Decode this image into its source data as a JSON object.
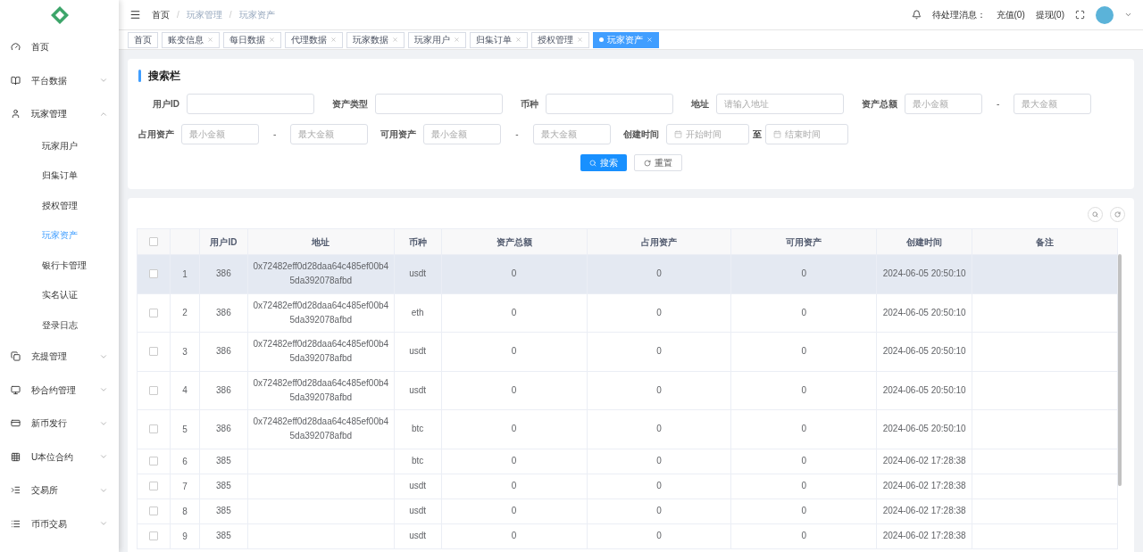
{
  "sidebar": {
    "items": [
      {
        "label": "首页",
        "expandable": false,
        "expanded": false
      },
      {
        "label": "平台数据",
        "expandable": true,
        "expanded": false
      },
      {
        "label": "玩家管理",
        "expandable": true,
        "expanded": true,
        "children": [
          {
            "label": "玩家用户",
            "selected": false
          },
          {
            "label": "归集订单",
            "selected": false
          },
          {
            "label": "授权管理",
            "selected": false
          },
          {
            "label": "玩家资产",
            "selected": true
          },
          {
            "label": "银行卡管理",
            "selected": false
          },
          {
            "label": "实名认证",
            "selected": false
          },
          {
            "label": "登录日志",
            "selected": false
          }
        ]
      },
      {
        "label": "充提管理",
        "expandable": true,
        "expanded": false
      },
      {
        "label": "秒合约管理",
        "expandable": true,
        "expanded": false
      },
      {
        "label": "新币发行",
        "expandable": true,
        "expanded": false
      },
      {
        "label": "U本位合约",
        "expandable": true,
        "expanded": false
      },
      {
        "label": "交易所",
        "expandable": true,
        "expanded": false
      },
      {
        "label": "币币交易",
        "expandable": true,
        "expanded": false
      }
    ]
  },
  "breadcrumb": {
    "separator": "/",
    "items": [
      "首页",
      "玩家管理",
      "玩家资产"
    ]
  },
  "header": {
    "message_label": "待处理消息：",
    "messages": [
      "充值(0)",
      "提现(0)"
    ]
  },
  "tags": [
    {
      "label": "首页",
      "closable": false,
      "selected": false
    },
    {
      "label": "账变信息",
      "closable": true,
      "selected": false
    },
    {
      "label": "每日数据",
      "closable": true,
      "selected": false
    },
    {
      "label": "代理数据",
      "closable": true,
      "selected": false
    },
    {
      "label": "玩家数据",
      "closable": true,
      "selected": false
    },
    {
      "label": "玩家用户",
      "closable": true,
      "selected": false
    },
    {
      "label": "归集订单",
      "closable": true,
      "selected": false
    },
    {
      "label": "授权管理",
      "closable": true,
      "selected": false
    },
    {
      "label": "玩家资产",
      "closable": true,
      "selected": true
    }
  ],
  "search": {
    "title": "搜索栏",
    "row1": [
      {
        "kind": "text",
        "label": "用户ID"
      },
      {
        "kind": "text",
        "label": "资产类型"
      },
      {
        "kind": "text",
        "label": "币种"
      },
      {
        "kind": "text",
        "label": "地址",
        "placeholder": "请输入地址"
      },
      {
        "kind": "range",
        "label": "资产总额",
        "min_placeholder": "最小金额",
        "max_placeholder": "最大金额",
        "separator": "-"
      }
    ],
    "row2": [
      {
        "kind": "range",
        "label": "占用资产",
        "min_placeholder": "最小金额",
        "max_placeholder": "最大金额",
        "separator": "-"
      },
      {
        "kind": "range",
        "label": "可用资产",
        "min_placeholder": "最小金额",
        "max_placeholder": "最大金额",
        "separator": "-"
      },
      {
        "kind": "date",
        "label": "创建时间",
        "min_placeholder": "开始时间",
        "max_placeholder": "结束时间",
        "separator": "至"
      }
    ],
    "search_button": "搜索",
    "reset_button": "重置"
  },
  "table": {
    "select_all_checked": false,
    "columns": [
      "用户ID",
      "地址",
      "币种",
      "资产总额",
      "占用资产",
      "可用资产",
      "创建时间",
      "备注"
    ],
    "rows": [
      {
        "index": "1",
        "user_id": "386",
        "address": "0x72482eff0d28daa64c485ef00b45da392078afbd",
        "coin": "usdt",
        "total": "0",
        "occupied": "0",
        "available": "0",
        "created": "2024-06-05 20:50:10",
        "highlighted": true,
        "checked": false
      },
      {
        "index": "2",
        "user_id": "386",
        "address": "0x72482eff0d28daa64c485ef00b45da392078afbd",
        "coin": "eth",
        "total": "0",
        "occupied": "0",
        "available": "0",
        "created": "2024-06-05 20:50:10",
        "highlighted": false,
        "checked": false
      },
      {
        "index": "3",
        "user_id": "386",
        "address": "0x72482eff0d28daa64c485ef00b45da392078afbd",
        "coin": "usdt",
        "total": "0",
        "occupied": "0",
        "available": "0",
        "created": "2024-06-05 20:50:10",
        "highlighted": false,
        "checked": false
      },
      {
        "index": "4",
        "user_id": "386",
        "address": "0x72482eff0d28daa64c485ef00b45da392078afbd",
        "coin": "usdt",
        "total": "0",
        "occupied": "0",
        "available": "0",
        "created": "2024-06-05 20:50:10",
        "highlighted": false,
        "checked": false
      },
      {
        "index": "5",
        "user_id": "386",
        "address": "0x72482eff0d28daa64c485ef00b45da392078afbd",
        "coin": "btc",
        "total": "0",
        "occupied": "0",
        "available": "0",
        "created": "2024-06-05 20:50:10",
        "highlighted": false,
        "checked": false
      },
      {
        "index": "6",
        "user_id": "385",
        "coin": "btc",
        "total": "0",
        "occupied": "0",
        "available": "0",
        "created": "2024-06-02 17:28:38",
        "highlighted": false,
        "checked": false
      },
      {
        "index": "7",
        "user_id": "385",
        "coin": "usdt",
        "total": "0",
        "occupied": "0",
        "available": "0",
        "created": "2024-06-02 17:28:38",
        "highlighted": false,
        "checked": false
      },
      {
        "index": "8",
        "user_id": "385",
        "coin": "usdt",
        "total": "0",
        "occupied": "0",
        "available": "0",
        "created": "2024-06-02 17:28:38",
        "highlighted": false,
        "checked": false
      },
      {
        "index": "9",
        "user_id": "385",
        "coin": "usdt",
        "total": "0",
        "occupied": "0",
        "available": "0",
        "created": "2024-06-02 17:28:38",
        "highlighted": false,
        "checked": false
      }
    ]
  }
}
